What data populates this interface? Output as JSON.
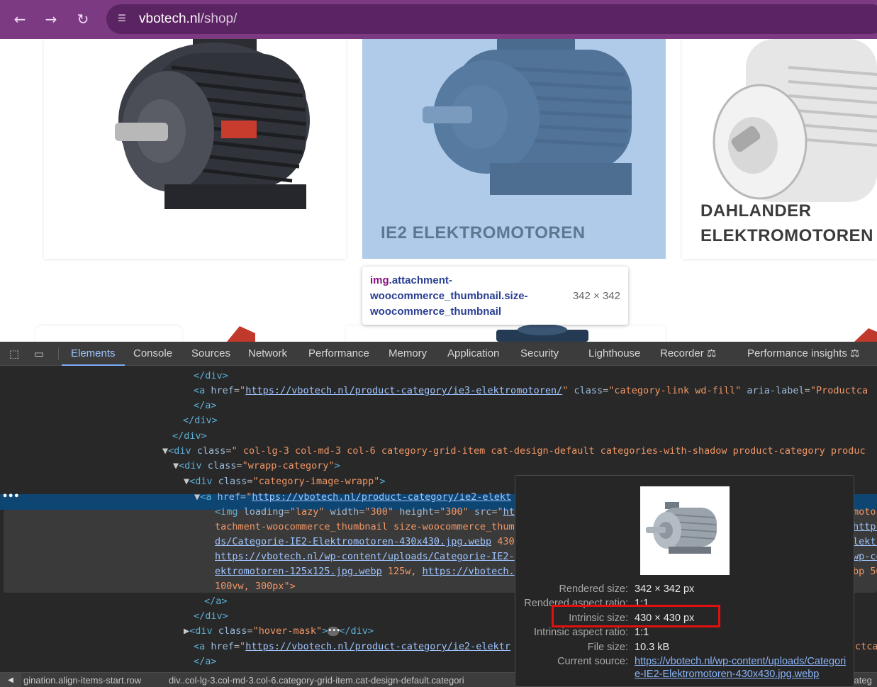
{
  "browser": {
    "url_domain": "vbotech.nl",
    "url_path": "/shop/"
  },
  "page": {
    "categories": [
      {
        "title": "IE2 ELEKTROMOTOREN"
      },
      {
        "title_line1": "DAHLANDER",
        "title_line2": "ELEKTROMOTOREN"
      }
    ]
  },
  "inspect_tooltip": {
    "tag": "img",
    "classes": ".attachment-woocommerce_thumbnail.size-woocommerce_thumbnail",
    "size": "342 × 342"
  },
  "devtools": {
    "tabs": [
      "Elements",
      "Console",
      "Sources",
      "Network",
      "Performance",
      "Memory",
      "Application",
      "Security",
      "Lighthouse",
      "Recorder",
      "Performance insights"
    ],
    "active_tab": "Elements",
    "code": {
      "l1": "</div>",
      "l2_href": "https://vbotech.nl/product-category/ie3-elektromotoren/",
      "l2_class": "category-link wd-fill",
      "l2_aria": "Productca",
      "l3": "</a>",
      "l4": "</div>",
      "l5": "</div>",
      "l6_class": " col-lg-3 col-md-3 col-6 category-grid-item cat-design-default categories-with-shadow product-category produc",
      "l7_class": "wrapp-category",
      "l8_class": "category-image-wrapp",
      "l9_href": "https://vbotech.nl/product-category/ie2-elekt",
      "l10_loading": "lazy",
      "l10_width": "300",
      "l10_height": "300",
      "l10_src": "ht",
      "l10_right": "moto",
      "l11": "tachment-woocommerce_thumbnail size-woocommerce_thum",
      "l11_right": "https",
      "l12": "ds/Categorie-IE2-Elektromotoren-430x430.jpg.webp",
      "l12_mid": "430",
      "l12_right": "lektr",
      "l13": "https://vbotech.nl/wp-content/uploads/Categorie-IE2-",
      "l13_right": "wp-co",
      "l14_link": "ektromotoren-125x125.jpg.webp",
      "l14_mid": "125w,",
      "l14_link2": "https://vbotech.",
      "l14_right": "bp 50",
      "l15": "100vw, 300px\">",
      "l16": "</a>",
      "l17": "</div>",
      "l18_class": "hover-mask",
      "l19_href": "https://vbotech.nl/product-category/ie2-elektr",
      "l19_right": "ctca",
      "l20": "</a>"
    },
    "breadcrumb": {
      "item1": "gination.align-items-start.row",
      "item2": "div..col-lg-3.col-md-3.col-6.category-grid-item.cat-design-default.categori",
      "item3": "categ"
    }
  },
  "image_preview": {
    "rendered_size_label": "Rendered size:",
    "rendered_size": "342 × 342 px",
    "rendered_ratio_label": "Rendered aspect ratio:",
    "rendered_ratio": "1:1",
    "intrinsic_size_label": "Intrinsic size:",
    "intrinsic_size": "430 × 430 px",
    "intrinsic_ratio_label": "Intrinsic aspect ratio:",
    "intrinsic_ratio": "1:1",
    "file_size_label": "File size:",
    "file_size": "10.3 kB",
    "current_source_label": "Current source:",
    "current_source": "https://vbotech.nl/wp-content/uploads/Categorie-IE2-Elektromotoren-430x430.jpg.webp"
  },
  "colors": {
    "browser_bar": "#7c3a82",
    "selection": "#0d4573",
    "highlight": "#e01010"
  }
}
